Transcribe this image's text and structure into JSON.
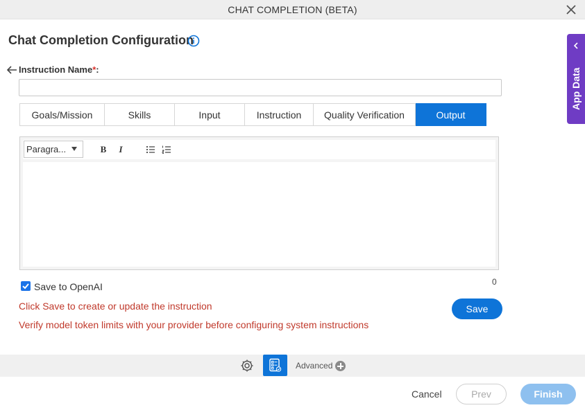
{
  "window": {
    "title": "CHAT COMPLETION (BETA)"
  },
  "page": {
    "heading": "Chat Completion Configuration"
  },
  "instruction": {
    "label": "Instruction Name",
    "required_mark": "*",
    "label_suffix": ":",
    "value": ""
  },
  "tabs": [
    {
      "label": "Goals/Mission",
      "active": false
    },
    {
      "label": "Skills",
      "active": false
    },
    {
      "label": "Input",
      "active": false
    },
    {
      "label": "Instruction",
      "active": false
    },
    {
      "label": "Quality Verification",
      "active": false
    },
    {
      "label": "Output",
      "active": true
    }
  ],
  "editor": {
    "paragraph_select": "Paragra...",
    "bold": "B",
    "italic": "I",
    "content": "",
    "char_count": "0"
  },
  "save_to_openai": {
    "label": "Save to OpenAI",
    "checked": true
  },
  "messages": {
    "save_hint": "Click Save to create or update the instruction",
    "token_warning": "Verify model token limits with your provider before configuring system instructions"
  },
  "buttons": {
    "save": "Save",
    "advanced": "Advanced",
    "cancel": "Cancel",
    "prev": "Prev",
    "finish": "Finish"
  },
  "side_panel": {
    "label": "App Data"
  },
  "icons": {
    "close": "close-icon",
    "info": "info-icon",
    "back": "arrow-left-icon",
    "bullet_list": "bullet-list-icon",
    "numbered_list": "numbered-list-icon",
    "gear": "gear-icon",
    "form": "form-icon",
    "plus": "plus-circle-icon",
    "chevron": "chevron-left-icon"
  },
  "colors": {
    "accent": "#0e74d8",
    "error_text": "#c0392b",
    "side_panel": "#6f3cc4",
    "finish_disabled": "#8ec0ef"
  }
}
